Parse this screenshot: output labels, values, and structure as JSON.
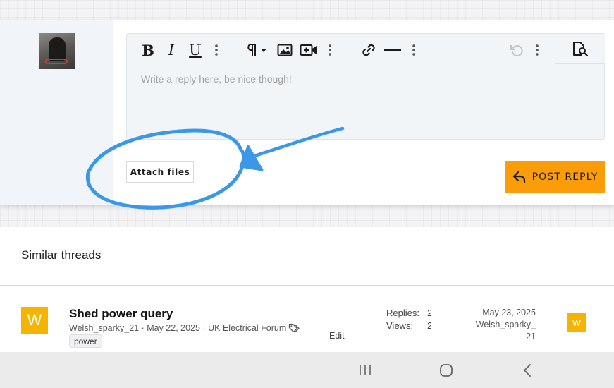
{
  "editor": {
    "placeholder": "Write a reply here, be nice though!",
    "toolbar": {
      "bold_label": "B",
      "italic_label": "I",
      "underline_label": "U"
    }
  },
  "actions": {
    "attach_label": "Attach files",
    "post_reply_label": "POST REPLY"
  },
  "similar_threads": {
    "heading": "Similar threads",
    "items": [
      {
        "avatar_letter": "W",
        "title": "Shed power query",
        "author": "Welsh_sparky_21",
        "date": "May 22, 2025",
        "forum": "UK Electrical Forum",
        "tag": "power",
        "edit_label": "Edit",
        "replies_label": "Replies:",
        "replies_value": "2",
        "views_label": "Views:",
        "views_value": "2",
        "last_post_date": "May 23, 2025",
        "last_post_user_line1": "Welsh_sparky_",
        "last_post_user_line2": "21",
        "last_avatar_letter": "W"
      }
    ]
  },
  "colors": {
    "accent": "#fb9d08",
    "avatar_bg": "#f5b400",
    "annotation": "#3b97e8"
  }
}
